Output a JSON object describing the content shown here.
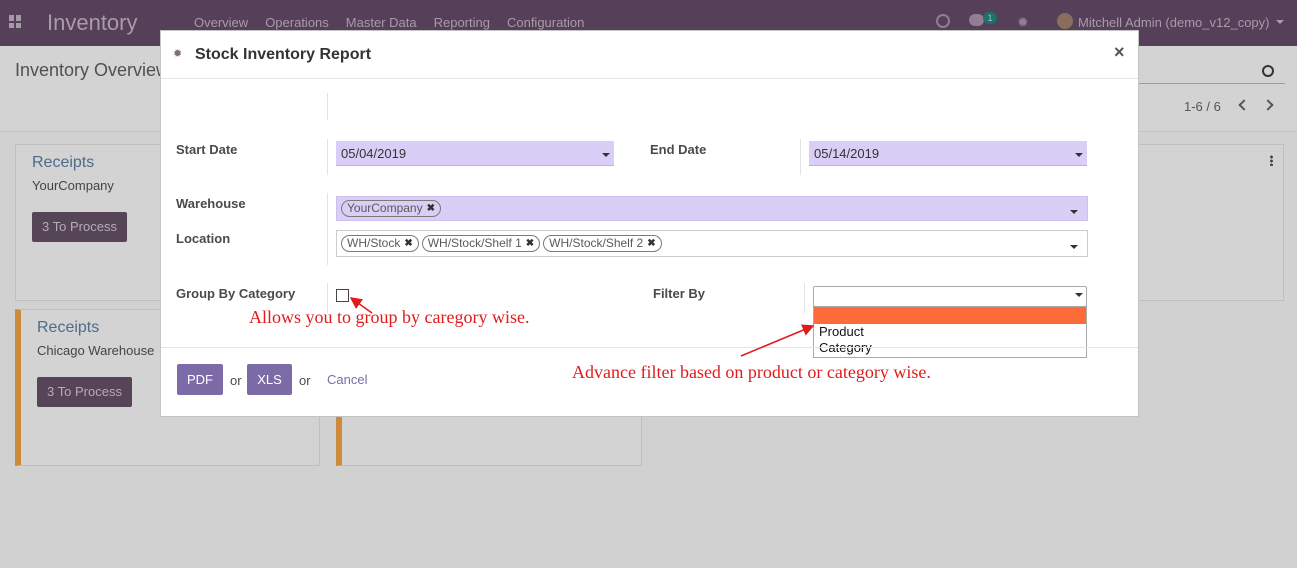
{
  "navbar": {
    "brand": "Inventory",
    "menu": [
      "Overview",
      "Operations",
      "Master Data",
      "Reporting",
      "Configuration"
    ],
    "chat_count": "1",
    "user": "Mitchell Admin (demo_v12_copy)"
  },
  "control_panel": {
    "title": "Inventory Overview",
    "pager": "1-6 / 6"
  },
  "cards": [
    {
      "title": "Receipts",
      "subtitle": "YourCompany",
      "button": "3 To Process"
    },
    {
      "title": "Receipts",
      "subtitle": "Chicago Warehouse",
      "button": "3 To Process"
    }
  ],
  "modal": {
    "title": "Stock Inventory Report",
    "close": "×",
    "start_date_label": "Start Date",
    "start_date_value": "05/04/2019",
    "end_date_label": "End Date",
    "end_date_value": "05/14/2019",
    "warehouse_label": "Warehouse",
    "warehouse_tags": [
      "YourCompany"
    ],
    "location_label": "Location",
    "location_tags": [
      "WH/Stock",
      "WH/Stock/Shelf 1",
      "WH/Stock/Shelf 2"
    ],
    "group_by_label": "Group By Category",
    "filter_by_label": "Filter By",
    "filter_options": [
      "",
      "Product",
      "Category"
    ],
    "pdf_button": "PDF",
    "or_1": "or",
    "xls_button": "XLS",
    "or_2": "or",
    "cancel": "Cancel"
  },
  "annotations": {
    "group_note": "Allows you to group by caregory wise.",
    "filter_note": "Advance filter based on product or category wise."
  },
  "colors": {
    "navbar": "#563f58",
    "primary": "#7c6ba6",
    "input_bg": "#d9cef5",
    "selected_option": "#ff6a39",
    "annotation": "#e01b1b"
  }
}
